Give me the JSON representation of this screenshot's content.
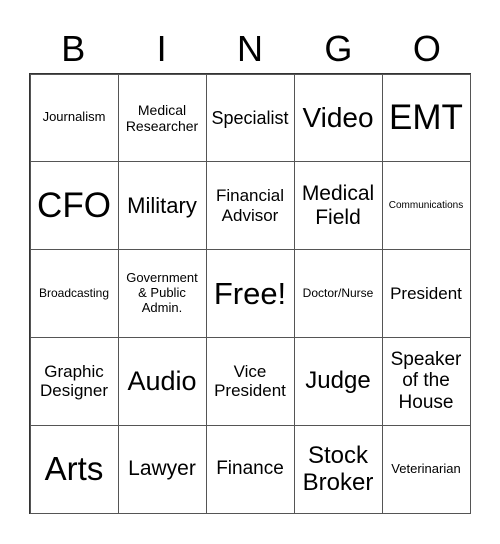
{
  "header": [
    "B",
    "I",
    "N",
    "G",
    "O"
  ],
  "cells": [
    "Journalism",
    "Medical Researcher",
    "Specialist",
    "Video",
    "EMT",
    "CFO",
    "Military",
    "Financial Advisor",
    "Medical Field",
    "Communications",
    "Broadcasting",
    "Government & Public Admin.",
    "Free!",
    "Doctor/Nurse",
    "President",
    "Graphic Designer",
    "Audio",
    "Vice President",
    "Judge",
    "Speaker of the House",
    "Arts",
    "Lawyer",
    "Finance",
    "Stock Broker",
    "Veterinarian"
  ]
}
